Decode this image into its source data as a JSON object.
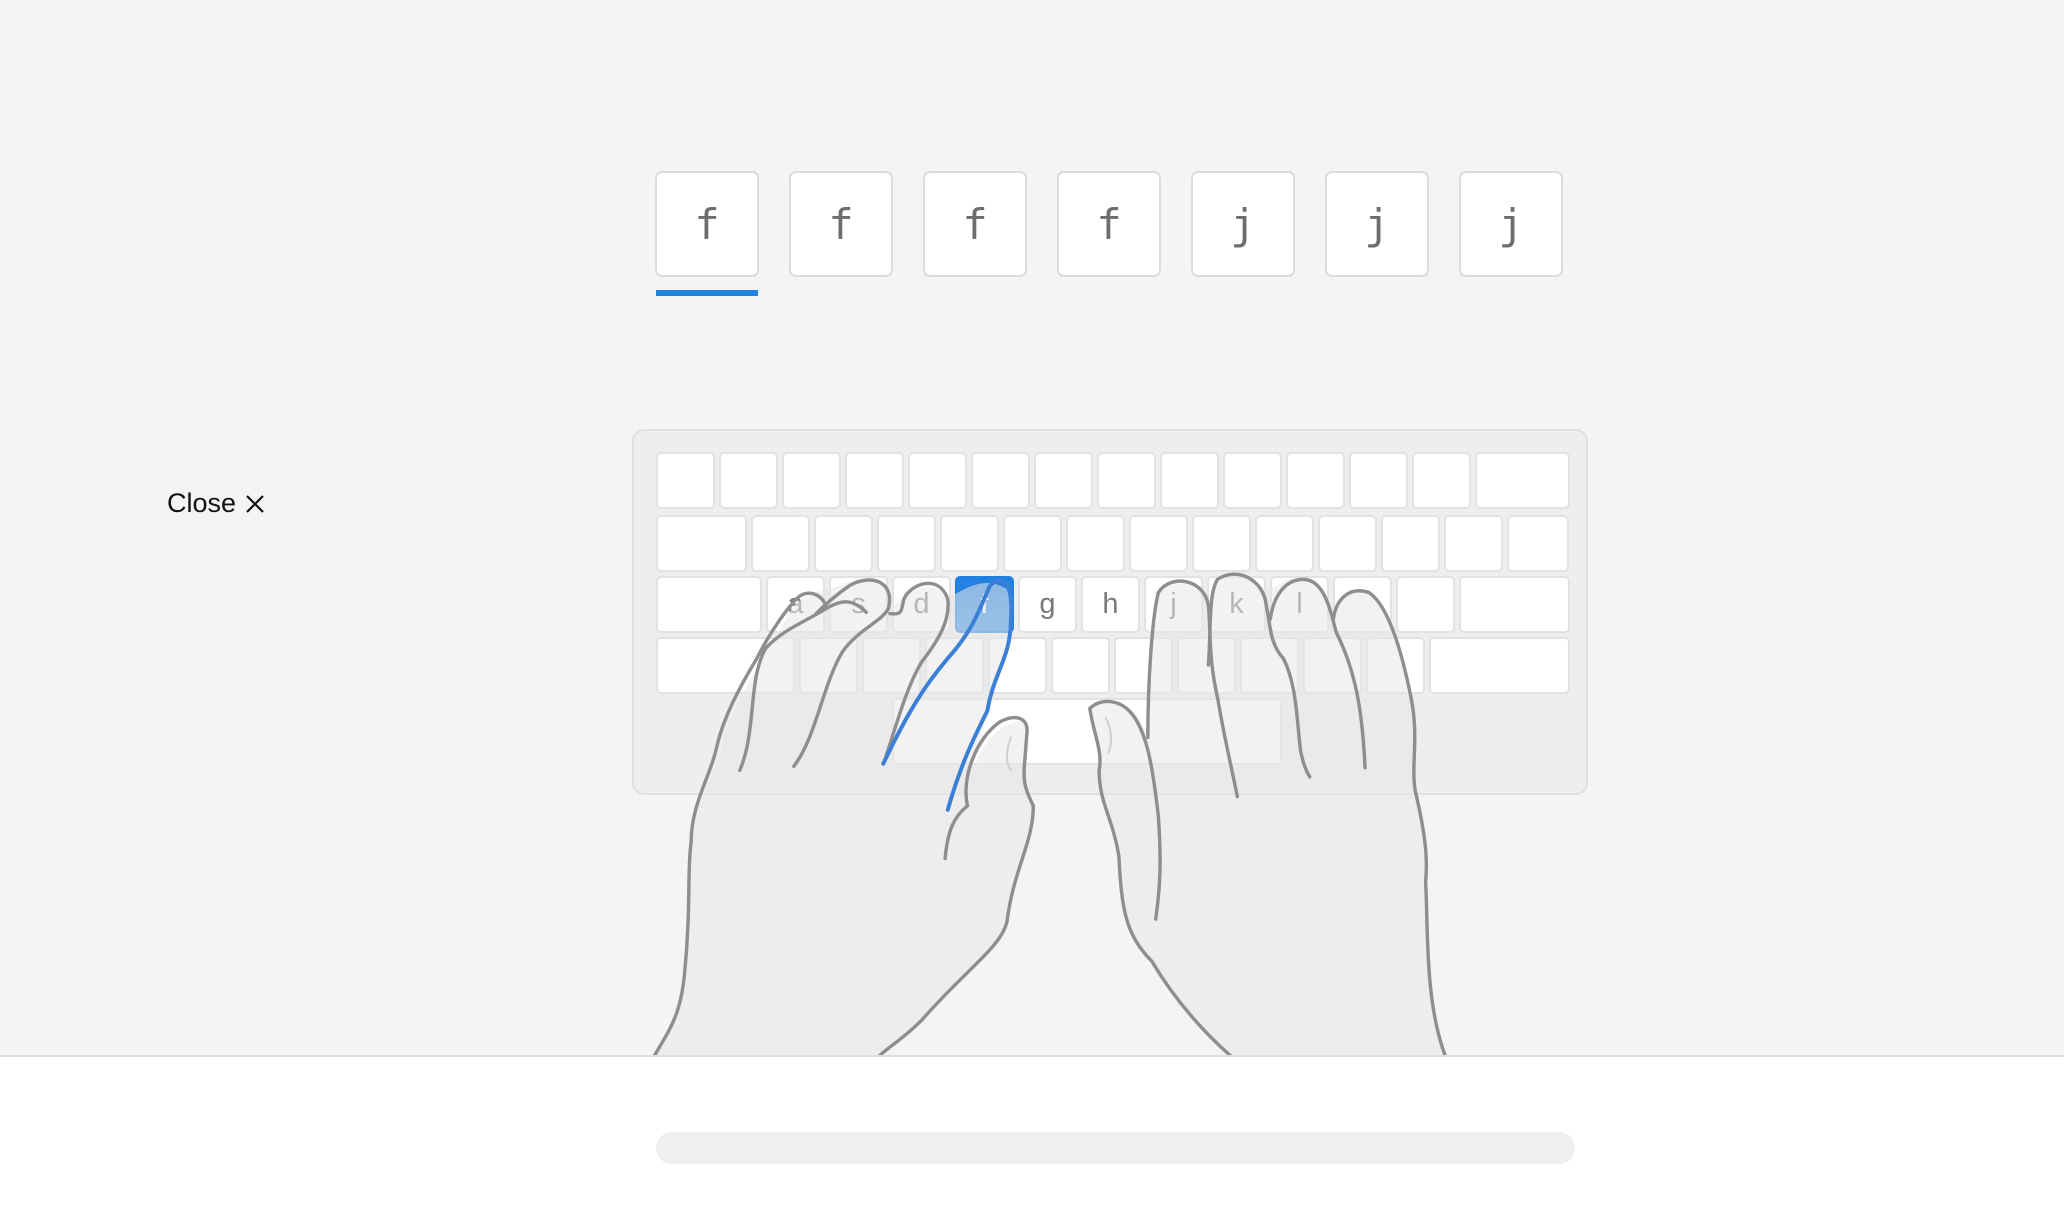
{
  "close": {
    "label": "Close",
    "icon": "close-x-icon"
  },
  "lesson": {
    "characters": [
      "f",
      "f",
      "f",
      "f",
      "j",
      "j",
      "j"
    ],
    "current_index": 0
  },
  "keyboard": {
    "rows": [
      [
        "",
        "",
        "",
        "",
        "",
        "",
        "",
        "",
        "",
        "",
        "",
        "",
        "",
        ""
      ],
      [
        "",
        "",
        "",
        "",
        "",
        "",
        "",
        "",
        "",
        "",
        "",
        "",
        "",
        ""
      ],
      [
        "",
        "a",
        "s",
        "d",
        "f",
        "g",
        "h",
        "j",
        "k",
        "l",
        "",
        "",
        ""
      ],
      [
        "",
        "",
        "",
        "",
        "",
        "",
        "",
        "",
        "",
        "",
        "",
        ""
      ],
      [
        ""
      ]
    ],
    "active_key": "f"
  },
  "hands": {
    "active_finger": "left-index"
  },
  "progress": {
    "fraction": 0
  },
  "colors": {
    "accent": "#1e84e0",
    "hand_outline": "#8e8e8e",
    "active_finger": "#3b7fd6"
  }
}
